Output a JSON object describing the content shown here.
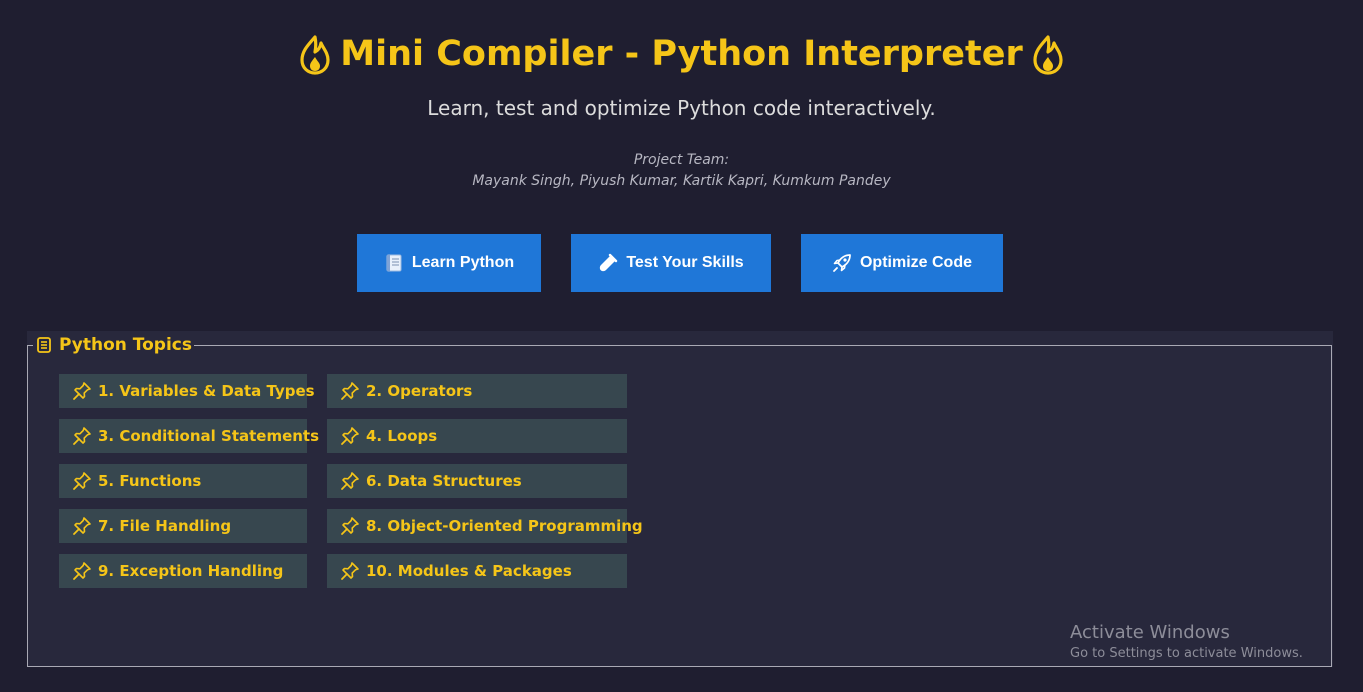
{
  "header": {
    "title": "Mini Compiler - Python Interpreter",
    "subtitle": "Learn, test and optimize Python code interactively.",
    "team_label": "Project Team:",
    "team_names": "Mayank Singh, Piyush Kumar, Kartik Kapri, Kumkum Pandey",
    "title_icon": "fire-icon"
  },
  "nav": {
    "learn": {
      "label": "Learn Python",
      "icon": "book-icon"
    },
    "test": {
      "label": "Test Your Skills",
      "icon": "test-tube-icon"
    },
    "optimize": {
      "label": "Optimize Code",
      "icon": "rocket-icon"
    }
  },
  "topics": {
    "legend": "Python Topics",
    "legend_icon": "scroll-icon",
    "item_icon": "pin-icon",
    "items": [
      "1. Variables & Data Types",
      "2. Operators",
      "3. Conditional Statements",
      "4. Loops",
      "5. Functions",
      "6. Data Structures",
      "7. File Handling",
      "8. Object-Oriented Programming",
      "9. Exception Handling",
      "10. Modules & Packages"
    ]
  },
  "watermark": {
    "title": "Activate Windows",
    "subtitle": "Go to Settings to activate Windows."
  },
  "colors": {
    "background": "#1f1e30",
    "accent": "#f5c518",
    "button": "#1f77d8",
    "topic_bg": "#37474f",
    "panel_bg": "#28283c"
  }
}
